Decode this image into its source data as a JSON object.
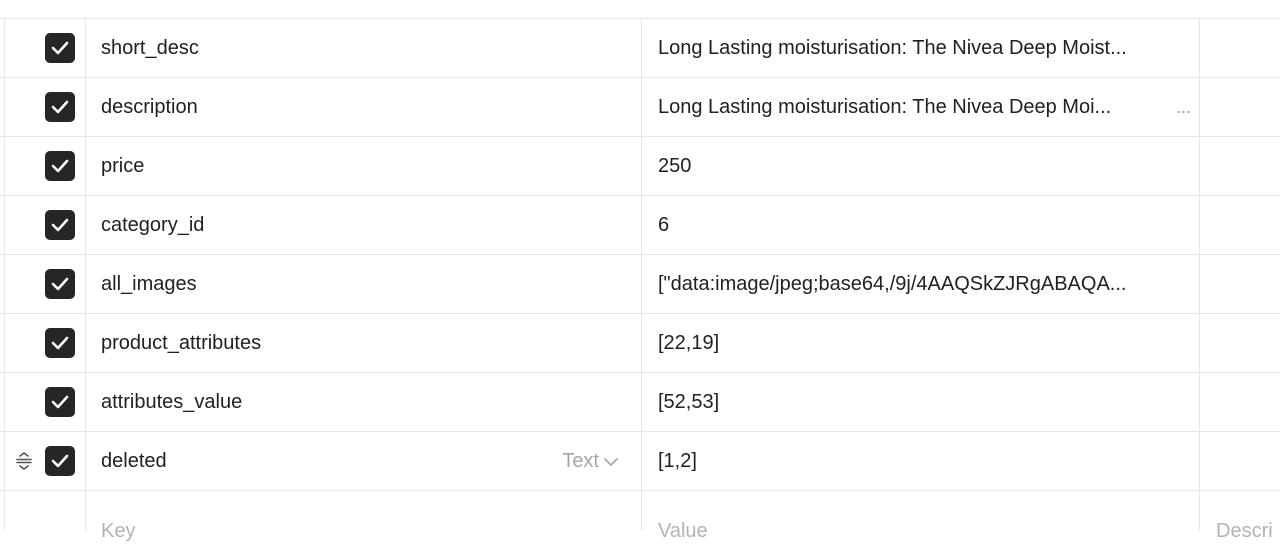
{
  "rows": [
    {
      "key": "short_desc",
      "value": "Long Lasting moisturisation: The Nivea Deep Moist..."
    },
    {
      "key": "description",
      "value": "Long Lasting moisturisation: The Nivea Deep Moi...",
      "more": "..."
    },
    {
      "key": "price",
      "value": "250"
    },
    {
      "key": "category_id",
      "value": "6"
    },
    {
      "key": "all_images",
      "value": "[\"data:image/jpeg;base64,/9j/4AAQSkZJRgABAQA..."
    },
    {
      "key": "product_attributes",
      "value": "[22,19]"
    },
    {
      "key": "attributes_value",
      "value": "[52,53]"
    },
    {
      "key": "deleted",
      "value": "[1,2]",
      "type": "Text"
    }
  ],
  "placeholders": {
    "key": "Key",
    "value": "Value",
    "description": "Descri"
  }
}
